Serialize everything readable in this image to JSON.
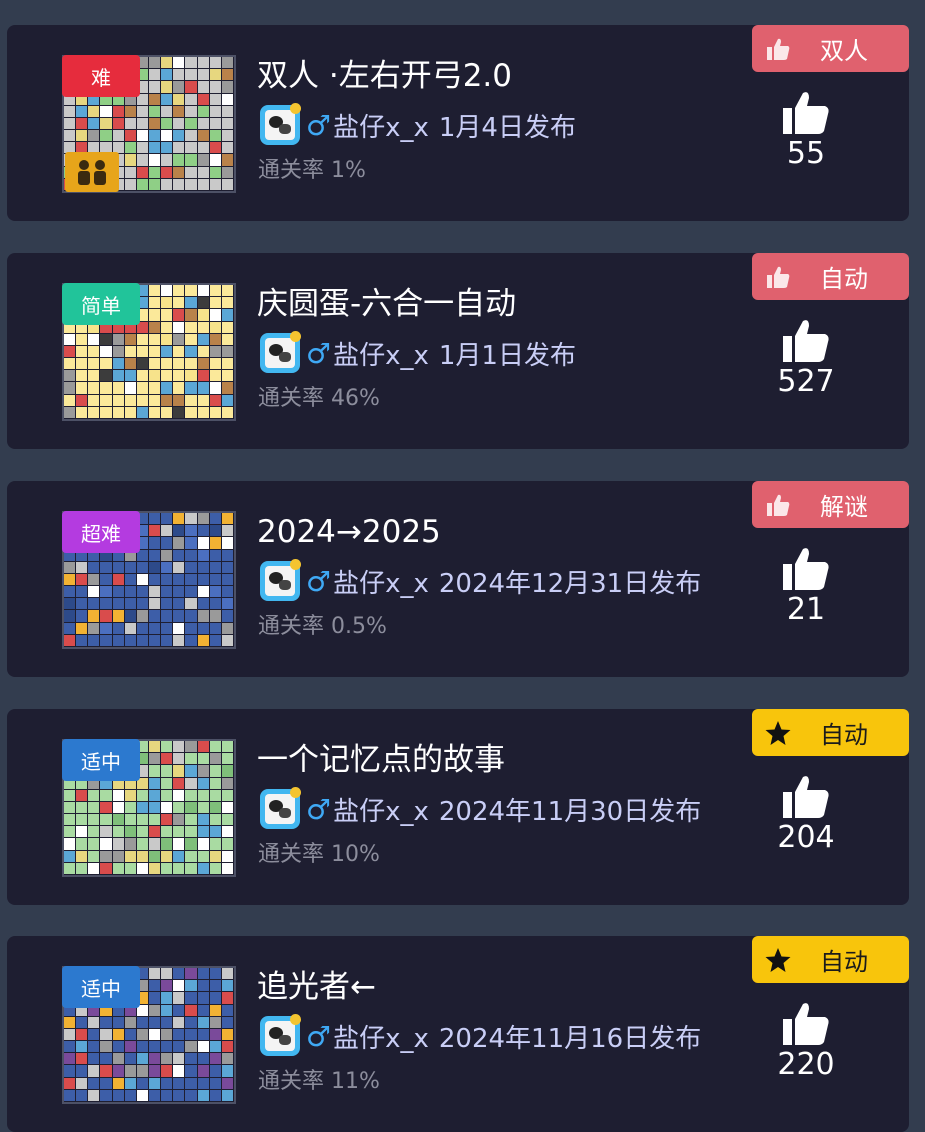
{
  "levels": [
    {
      "difficulty": "难",
      "difficulty_color": "#e62c3d",
      "title": "双人 ·左右开弓2.0",
      "author": "盐仔x_x",
      "publish": "1月4日发布",
      "pass_rate": "通关率 1%",
      "tag": "双人",
      "tag_icon": "thumbs-up-icon",
      "tag_color": "#e0616e",
      "likes": "55",
      "thumb_palette": [
        "#c9c9c9",
        "#9a9a9a",
        "#e7d77f",
        "#d94c4c",
        "#5ba7d6",
        "#8fcf86",
        "#ffffff",
        "#b9824a"
      ],
      "two_player": true
    },
    {
      "difficulty": "简单",
      "difficulty_color": "#21c49a",
      "title": "庆圆蛋-六合一自动",
      "author": "盐仔x_x",
      "publish": "1月1日发布",
      "pass_rate": "通关率 46%",
      "tag": "自动",
      "tag_icon": "thumbs-up-icon",
      "tag_color": "#e0616e",
      "likes": "527",
      "thumb_palette": [
        "#fbe99a",
        "#f7e38b",
        "#d94c4c",
        "#5ba7d6",
        "#3c3c3c",
        "#ffffff",
        "#b9824a",
        "#9a9a9a"
      ],
      "two_player": false
    },
    {
      "difficulty": "超难",
      "difficulty_color": "#b43be0",
      "title": "2024→2025",
      "author": "盐仔x_x",
      "publish": "2024年12月31日发布",
      "pass_rate": "通关率 0.5%",
      "tag": "解谜",
      "tag_icon": "thumbs-up-icon",
      "tag_color": "#e0616e",
      "likes": "21",
      "thumb_palette": [
        "#3d5ea8",
        "#4b6fc0",
        "#d94c4c",
        "#f2b233",
        "#9a9a9a",
        "#ffffff",
        "#c9c9c9",
        "#2d4a8a"
      ],
      "two_player": false
    },
    {
      "difficulty": "适中",
      "difficulty_color": "#2c79cf",
      "title": "一个记忆点的故事",
      "author": "盐仔x_x",
      "publish": "2024年11月30日发布",
      "pass_rate": "通关率 10%",
      "tag": "自动",
      "tag_icon": "star-icon",
      "tag_color": "#f8c50c",
      "likes": "204",
      "thumb_palette": [
        "#a9dba2",
        "#c9c9c9",
        "#9a9a9a",
        "#d94c4c",
        "#5ba7d6",
        "#e7d77f",
        "#ffffff",
        "#7fbf7a"
      ],
      "two_player": false
    },
    {
      "difficulty": "适中",
      "difficulty_color": "#2c79cf",
      "title": "追光者←",
      "author": "盐仔x_x",
      "publish": "2024年11月16日发布",
      "pass_rate": "通关率 11%",
      "tag": "自动",
      "tag_icon": "star-icon",
      "tag_color": "#f8c50c",
      "likes": "220",
      "thumb_palette": [
        "#3d5ea8",
        "#d94c4c",
        "#f2b233",
        "#ffffff",
        "#9a9a9a",
        "#5ba7d6",
        "#c9c9c9",
        "#7a4a9a"
      ],
      "two_player": false
    }
  ]
}
